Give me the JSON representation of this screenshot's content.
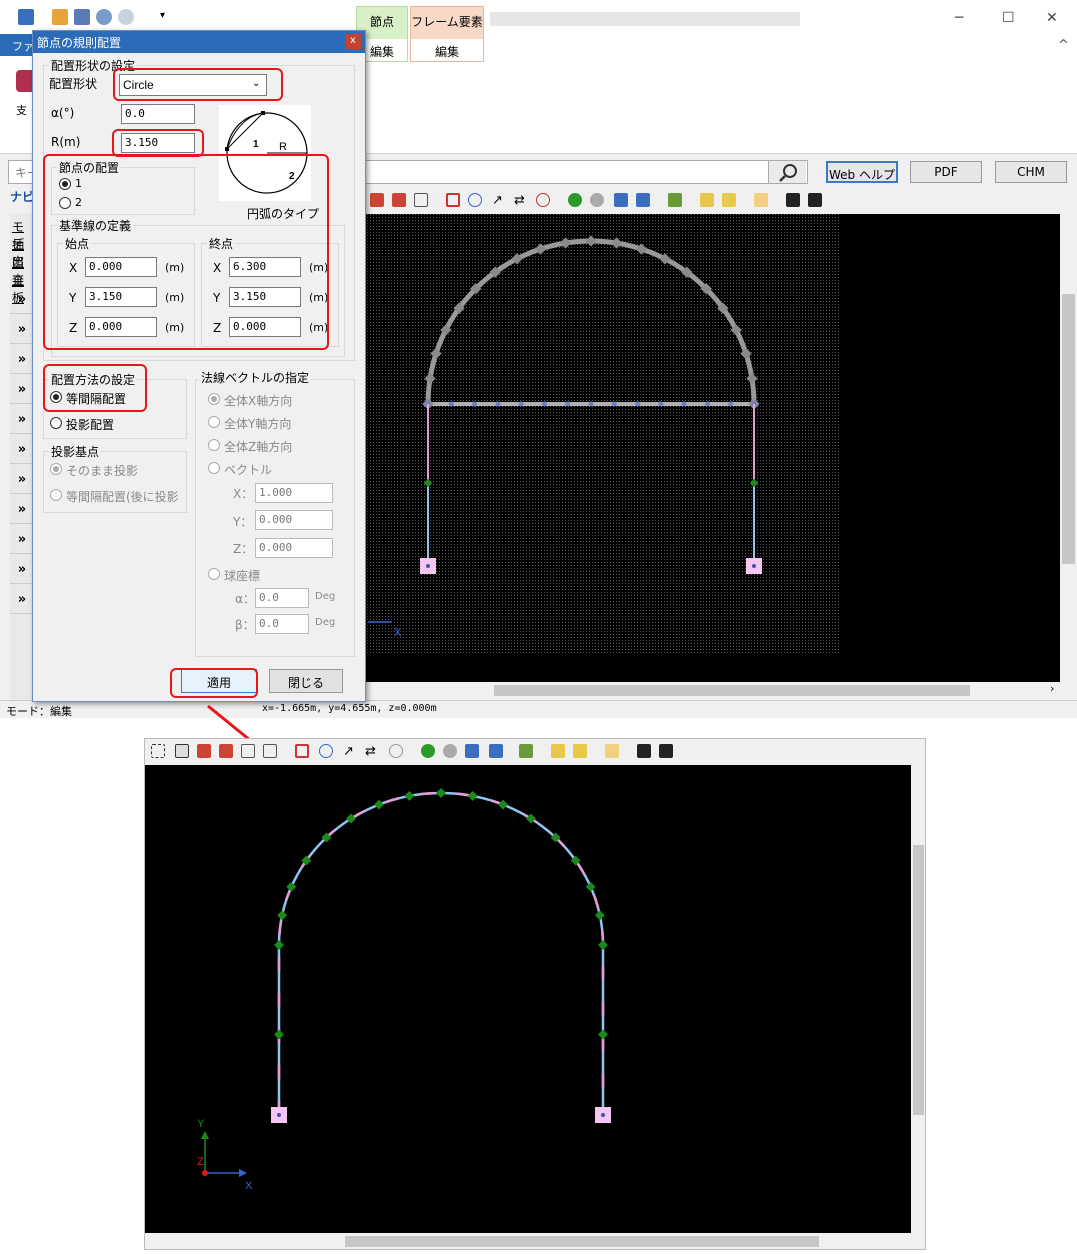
{
  "app": {
    "ribbon_tab_node": "節点",
    "ribbon_tab_frame": "フレーム要素",
    "ribbon_edit_1": "編集",
    "ribbon_edit_2": "編集",
    "file_tab": "ファ",
    "ribbon_left_label": "支",
    "search_placeholder": "キー",
    "help_buttons": [
      "Web ヘルプ",
      "PDF",
      "CHM"
    ],
    "win_min": "─",
    "win_max": "☐",
    "win_close": "✕",
    "win_expand": "^",
    "sidebar_nav": "ナビ",
    "sidebar_links": [
      "モデ",
      "抽出",
      "照査",
      "平板"
    ],
    "sidebar_chevron": "»",
    "status_mode": "モード：編集",
    "status_coords": "x=-1.665m, y=4.655m, z=0.000m"
  },
  "dialog": {
    "title": "節点の規則配置",
    "close": "x",
    "shape_group": "配置形状の設定",
    "shape_label": "配置形状",
    "shape_value": "Circle",
    "alpha_label": "α(°)",
    "alpha_value": "0.0",
    "r_label": "R(m)",
    "r_value": "3.150",
    "diagram_caption": "円弧のタイプ",
    "diagram_r": "R",
    "diagram_1": "1",
    "diagram_2": "2",
    "node_place_group": "節点の配置",
    "node_opt1": "1",
    "node_opt2": "2",
    "baseline_group": "基準線の定義",
    "start_label": "始点",
    "end_label": "終点",
    "axis_x": "X",
    "axis_y": "Y",
    "axis_z": "Z",
    "unit_m": "(m)",
    "start_x": "0.000",
    "start_y": "3.150",
    "start_z": "0.000",
    "end_x": "6.300",
    "end_y": "3.150",
    "end_z": "0.000",
    "method_group": "配置方法の設定",
    "method_equal": "等間隔配置",
    "method_proj": "投影配置",
    "proj_base_group": "投影基点",
    "proj_asis": "そのまま投影",
    "proj_equal": "等間隔配置(後に投影",
    "normal_group": "法線ベクトルの指定",
    "normal_x": "全体X軸方向",
    "normal_y": "全体Y軸方向",
    "normal_z": "全体Z軸方向",
    "normal_vec": "ベクトル",
    "vec_x_label": "X：",
    "vec_y_label": "Y：",
    "vec_z_label": "Z：",
    "vec_x": "1.000",
    "vec_y": "0.000",
    "vec_z": "0.000",
    "sphere": "球座標",
    "sph_alpha_label": "α：",
    "sph_beta_label": "β：",
    "sph_alpha": "0.0",
    "sph_beta": "0.0",
    "deg": "Deg",
    "apply": "適用",
    "close_btn": "閉じる"
  },
  "axes": {
    "x": "X",
    "y": "Y",
    "z": "Z"
  },
  "colors": {
    "annotation_red": "#e8161b",
    "arc_gray": "#9a9a9a",
    "member_blue": "#8fc6f0",
    "member_pink": "#e89bd8",
    "node_green": "#1a8a1a",
    "support_pink": "#f5c6f0",
    "title_blue": "#2b6cb8"
  }
}
